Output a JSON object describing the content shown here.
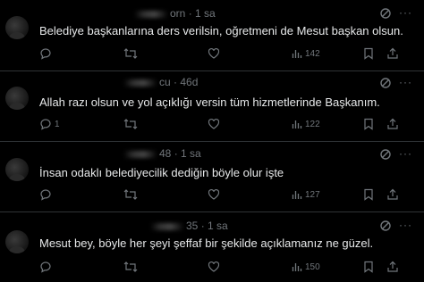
{
  "replies": [
    {
      "name_suffix": "orn",
      "time": "· 1 sa",
      "text": "Belediye başkanlarına ders verilsin, oğretmeni de Mesut başkan olsun.",
      "replies_count": "",
      "views": "142"
    },
    {
      "name_suffix": "cu",
      "time": "· 46d",
      "text": "Allah razı olsun ve yol açıklığı versin tüm hizmetlerinde Başkanım.",
      "replies_count": "1",
      "views": "122"
    },
    {
      "name_suffix": "48",
      "time": "· 1 sa",
      "text": "İnsan odaklı belediyecilik dediğin böyle olur işte",
      "replies_count": "",
      "views": "127"
    },
    {
      "name_suffix": "35",
      "time": "· 1 sa",
      "text": "Mesut bey, böyle her şeyi şeffaf bir şekilde açıklamanız ne güzel.",
      "replies_count": "",
      "views": "150"
    }
  ],
  "icons": {
    "reply": "reply-icon",
    "repost": "repost-icon",
    "like": "like-icon",
    "views": "views-icon",
    "bookmark": "bookmark-icon",
    "share": "share-icon",
    "grok": "grok-icon",
    "more": "more-icon"
  },
  "colors": {
    "background": "#000000",
    "text": "#e7e9ea",
    "muted": "#71767b",
    "separator": "#2f3336"
  }
}
